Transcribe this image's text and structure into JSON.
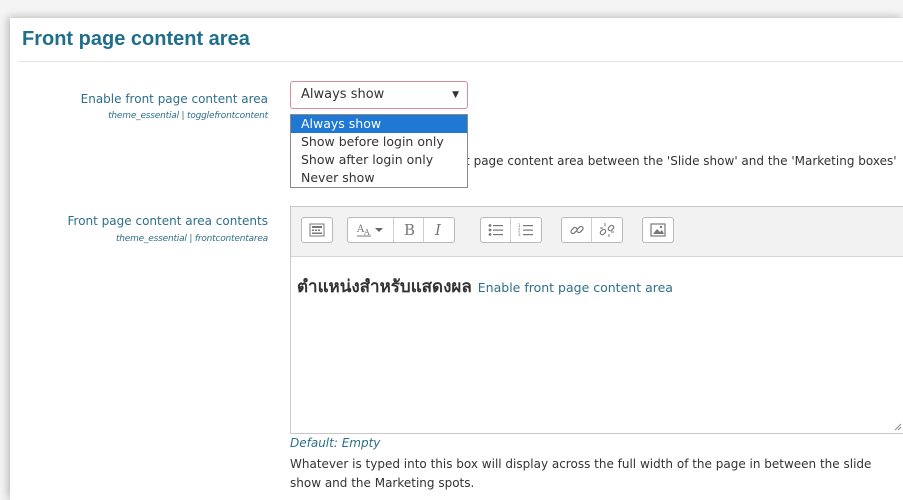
{
  "section": {
    "title": "Front page content area"
  },
  "toggle_setting": {
    "label": "Enable front page content area",
    "sub_label": "theme_essential | togglefrontcontent",
    "selected_value": "Always show",
    "options": [
      "Always show",
      "Show before login only",
      "Show after login only",
      "Never show"
    ],
    "description_line1": "Toggle the display of the front page content area between the 'Slide show' and the 'Marketing boxes'",
    "description_line2": "Default: Always show."
  },
  "content_setting": {
    "label": "Front page content area contents",
    "sub_label": "theme_essential | frontcontentarea",
    "editor": {
      "toolbar_icons": [
        "show-more-buttons-icon",
        "font-style-icon",
        "bold-icon",
        "italic-icon",
        "unordered-list-icon",
        "ordered-list-icon",
        "link-icon",
        "unlink-icon",
        "image-icon"
      ],
      "content_thai": "ตำแหน่งสำหรับแสดงผล",
      "content_english": "Enable front page content area"
    },
    "default_note": "Default: Empty",
    "help_text": "Whatever is typed into this box will display across the full width of the page in between the slide show and the Marketing spots."
  }
}
